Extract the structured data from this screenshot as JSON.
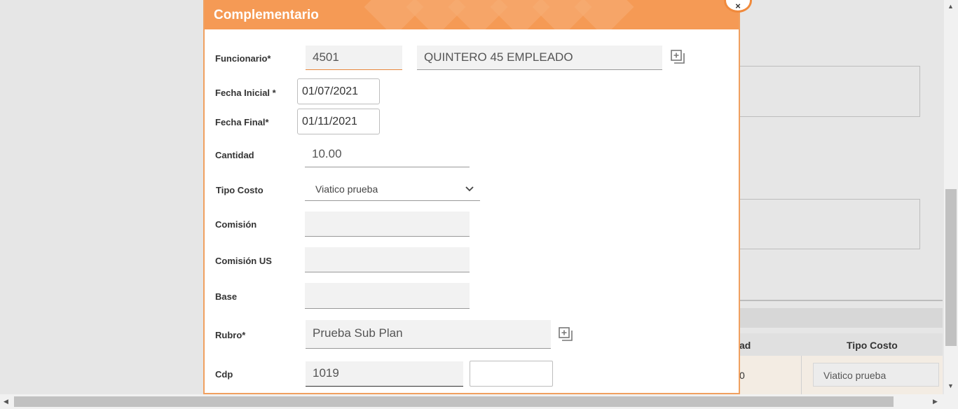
{
  "modal": {
    "title": "Complementario",
    "close_label": "×",
    "fields": {
      "funcionario_label": "Funcionario*",
      "funcionario_code": "4501",
      "funcionario_name": "QUINTERO 45 EMPLEADO",
      "fecha_inicial_label": "Fecha Inicial *",
      "fecha_inicial_value": "01/07/2021",
      "fecha_final_label": "Fecha Final*",
      "fecha_final_value": "01/11/2021",
      "cantidad_label": "Cantidad",
      "cantidad_value": "10.00",
      "tipo_costo_label": "Tipo Costo",
      "tipo_costo_value": "Viatico prueba",
      "comision_label": "Comisión",
      "comision_value": "",
      "comision_us_label": "Comisión US",
      "comision_us_value": "",
      "base_label": "Base",
      "base_value": "",
      "rubro_label": "Rubro*",
      "rubro_value": "Prueba Sub Plan",
      "cdp_label": "Cdp",
      "cdp_value": "1019",
      "cdp_extra_value": ""
    }
  },
  "background": {
    "table_header_partial": "ad",
    "table_header_tipo_costo": "Tipo Costo",
    "row_cell_partial": "0",
    "row_tipo_costo": "Viatico prueba"
  },
  "icons": {
    "lookup": "lookup-icon",
    "chevron": "chevron-down-icon",
    "close": "close-icon"
  },
  "colors": {
    "header_orange": "#f59a55",
    "accent_orange": "#e8873d"
  }
}
